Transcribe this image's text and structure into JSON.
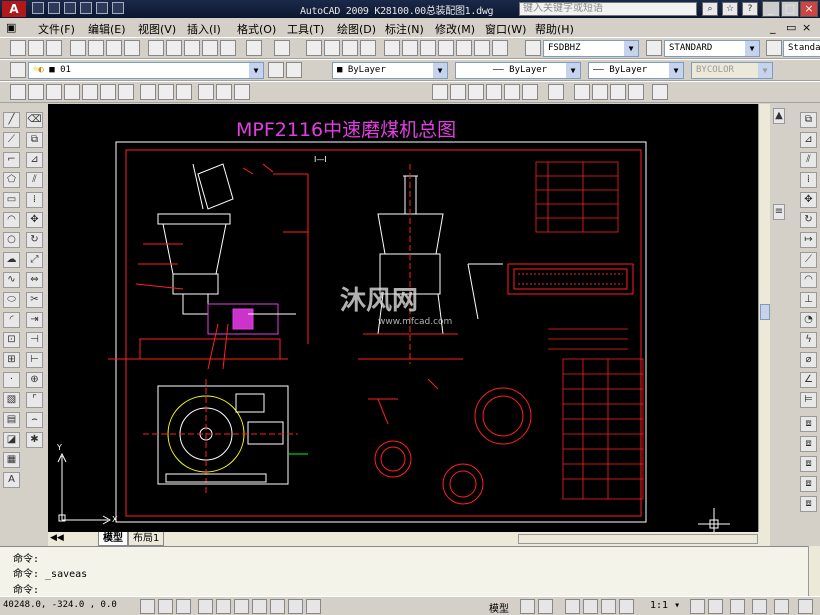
{
  "titlebar": {
    "title": "AutoCAD 2009  K28100.00总装配图1.dwg",
    "search_placeholder": "键入关键字或短语",
    "app_button": "A"
  },
  "menubar": {
    "items": [
      "文件(F)",
      "编辑(E)",
      "视图(V)",
      "插入(I)",
      "格式(O)",
      "工具(T)",
      "绘图(D)",
      "标注(N)",
      "修改(M)",
      "窗口(W)",
      "帮助(H)"
    ]
  },
  "styles_toolbar": {
    "text_style": "FSDBHZ",
    "dim_style": "STANDARD",
    "table_style": "Standar"
  },
  "layers_toolbar": {
    "current_layer": "01",
    "color": "ByLayer",
    "linetype": "ByLayer",
    "lineweight": "ByLayer",
    "plotstyle": "BYCOLOR"
  },
  "drawing": {
    "main_title": "MPF2116中速磨煤机总图",
    "section_label": "I—I",
    "watermark_text": "沐风网",
    "watermark_url": "www.mfcad.com"
  },
  "layout_tabs": [
    "模型",
    "布局1"
  ],
  "command_window": {
    "lines": [
      "命令:",
      "命令: _saveas",
      "命令:"
    ]
  },
  "statusbar": {
    "coordinates": "40248.0, -324.0 , 0.0",
    "space": "模型",
    "annotation_scale": "1:1"
  },
  "colors": {
    "canvas": "#000000",
    "title_magenta": "#e040e0",
    "drawing_red": "#ff2020",
    "drawing_white": "#ffffff",
    "accent_blue": "#1b2a4a"
  }
}
